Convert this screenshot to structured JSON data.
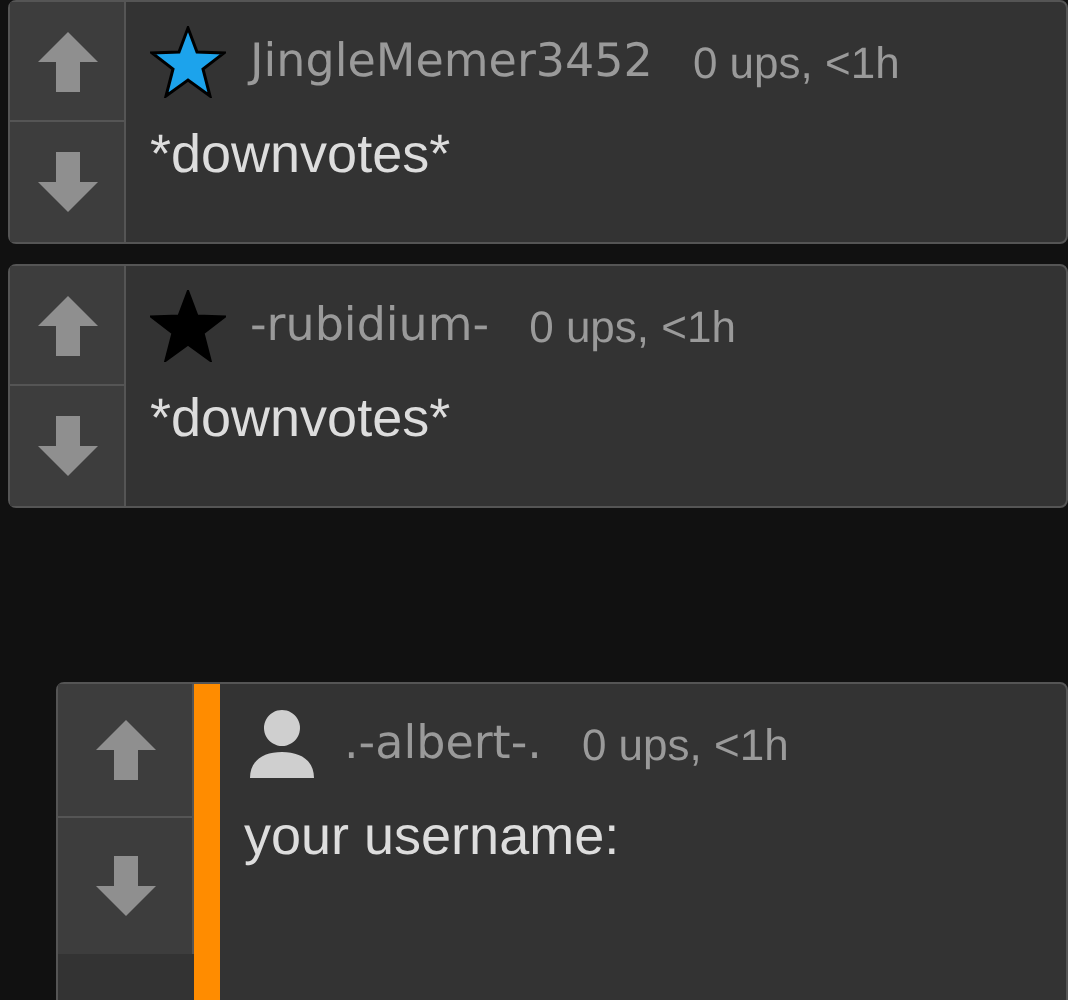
{
  "comments": [
    {
      "icon": {
        "kind": "star",
        "color": "#1ca3ec"
      },
      "username": "JingleMemer3452",
      "meta": "0 ups, <1h",
      "text": "*downvotes*",
      "highlighted": false
    },
    {
      "icon": {
        "kind": "star",
        "color": "#000000"
      },
      "username": "-rubidium-",
      "meta": "0 ups, <1h",
      "text": "*downvotes*",
      "highlighted": false
    },
    {
      "icon": {
        "kind": "avatar"
      },
      "username": ".-albert-.",
      "meta": "0 ups, <1h",
      "text": "your username:",
      "highlighted": true
    }
  ]
}
